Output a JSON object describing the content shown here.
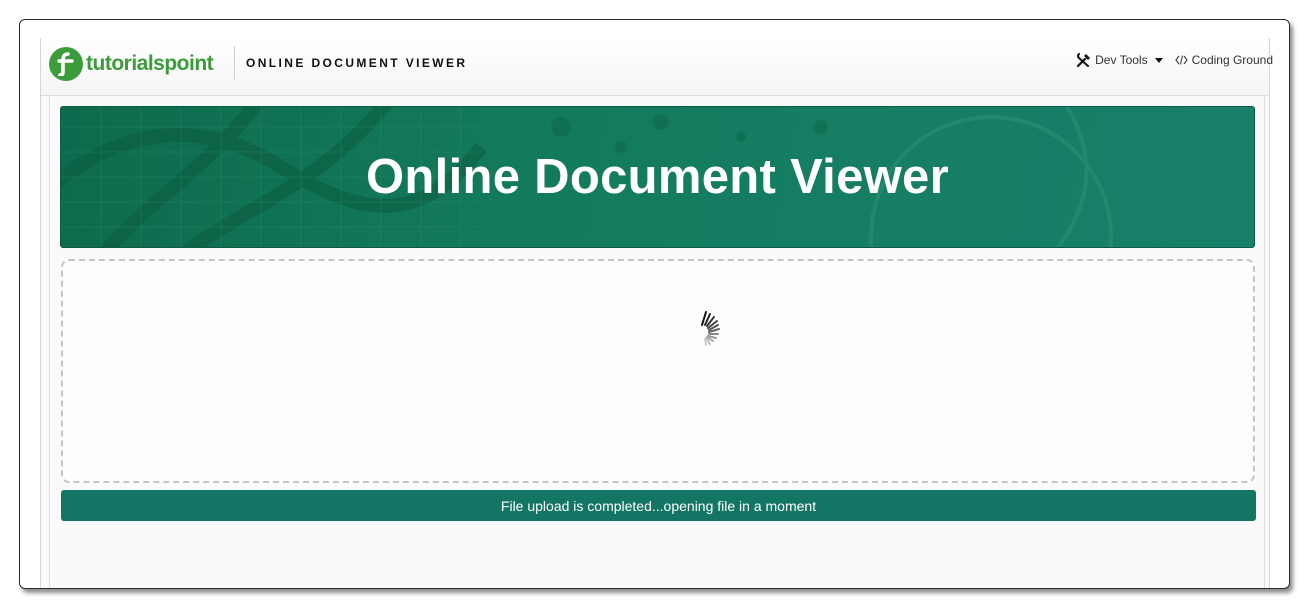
{
  "header": {
    "logo": {
      "part1": "tutorials",
      "part2": "point"
    },
    "title": "ONLINE DOCUMENT VIEWER",
    "nav": [
      {
        "label": "Dev Tools",
        "icon": "tools-icon",
        "has_dropdown": true
      },
      {
        "label": "Coding Ground",
        "icon": "code-icon"
      }
    ]
  },
  "banner": {
    "title": "Online Document Viewer"
  },
  "upload": {
    "status_text": "File upload is completed...opening file in a moment"
  },
  "colors": {
    "brand_green": "#3a9d3a",
    "banner_green": "#137b5c",
    "status_green": "#137563"
  }
}
